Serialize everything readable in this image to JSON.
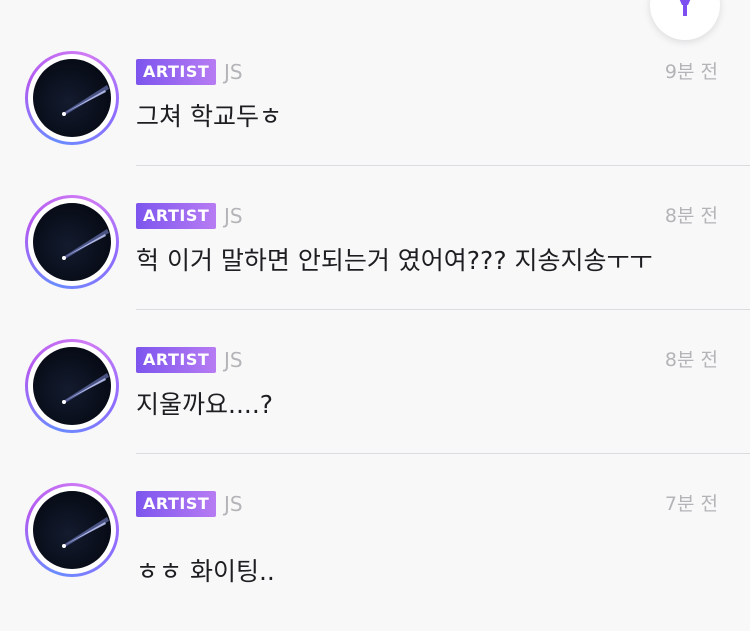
{
  "comments": [
    {
      "badge": "ARTIST",
      "name": "JS",
      "time": "9분 전",
      "text": "그쳐 학교두ㅎ"
    },
    {
      "badge": "ARTIST",
      "name": "JS",
      "time": "8분 전",
      "text": "헉 이거 말하면 안되는거 였어여??? 지송지송ㅜㅜ"
    },
    {
      "badge": "ARTIST",
      "name": "JS",
      "time": "8분 전",
      "text": "지울까요....?"
    },
    {
      "badge": "ARTIST",
      "name": "JS",
      "time": "7분 전",
      "text": "ㅎㅎ 화이팅.."
    }
  ],
  "fab_icon": "lightstick-icon",
  "colors": {
    "accent": "#7d55ee",
    "accent_light": "#b77cf3",
    "muted": "#b4b4b8"
  }
}
